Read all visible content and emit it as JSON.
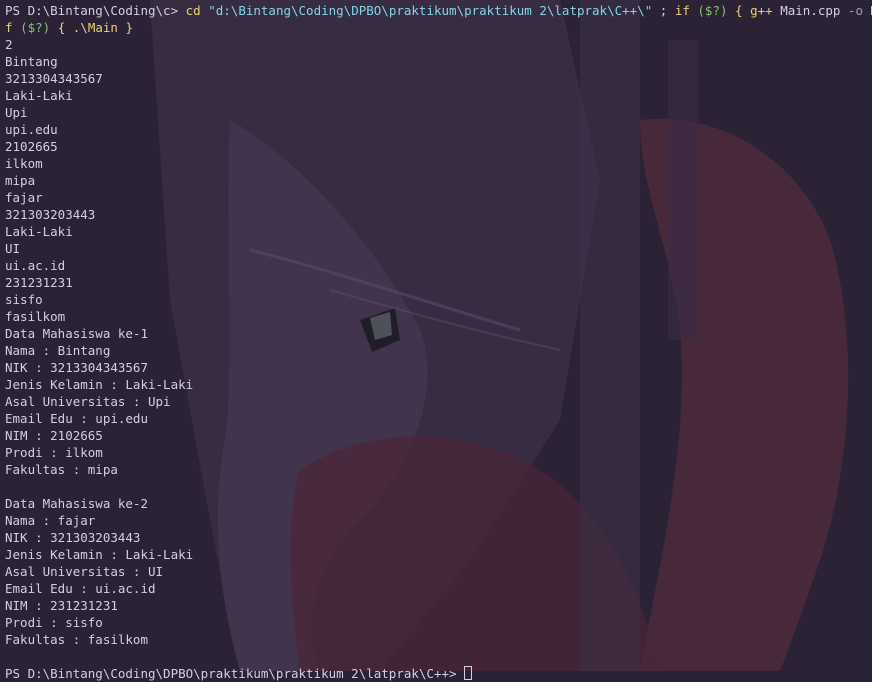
{
  "theme": {
    "background": "#2b2236",
    "foreground": "#d4cfe0",
    "command_color": "#e8d46a",
    "string_color": "#7fd6e6",
    "variable_color": "#7ec86f"
  },
  "command": {
    "prompt": "PS D:\\Bintang\\Coding\\c> ",
    "cd": "cd",
    "path": "\"d:\\Bintang\\Coding\\DPBO\\praktikum\\praktikum 2\\latprak\\C++\\\"",
    "sep1": " ; ",
    "if1": "if",
    "cond1": "($?)",
    "brace_open1": "{",
    "compiler": "g++",
    "compile_args": " Main.cpp ",
    "flag": "-o",
    "out_name": " Main ",
    "brace_close1": "}",
    "sep2": " ;",
    "wrap_prefix": "f ",
    "cond2": "($?)",
    "brace_open2": "{",
    "run": ".\\Main",
    "brace_close2": "}"
  },
  "output_lines": [
    "2",
    "Bintang",
    "3213304343567",
    "Laki-Laki",
    "Upi",
    "upi.edu",
    "2102665",
    "ilkom",
    "mipa",
    "fajar",
    "321303203443",
    "Laki-Laki",
    "UI",
    "ui.ac.id",
    "231231231",
    "sisfo",
    "fasilkom",
    "Data Mahasiswa ke-1",
    "Nama : Bintang",
    "NIK : 3213304343567",
    "Jenis Kelamin : Laki-Laki",
    "Asal Universitas : Upi",
    "Email Edu : upi.edu",
    "NIM : 2102665",
    "Prodi : ilkom",
    "Fakultas : mipa",
    "",
    "Data Mahasiswa ke-2",
    "Nama : fajar",
    "NIK : 321303203443",
    "Jenis Kelamin : Laki-Laki",
    "Asal Universitas : UI",
    "Email Edu : ui.ac.id",
    "NIM : 231231231",
    "Prodi : sisfo",
    "Fakultas : fasilkom",
    ""
  ],
  "final_prompt": "PS D:\\Bintang\\Coding\\DPBO\\praktikum\\praktikum 2\\latprak\\C++> "
}
